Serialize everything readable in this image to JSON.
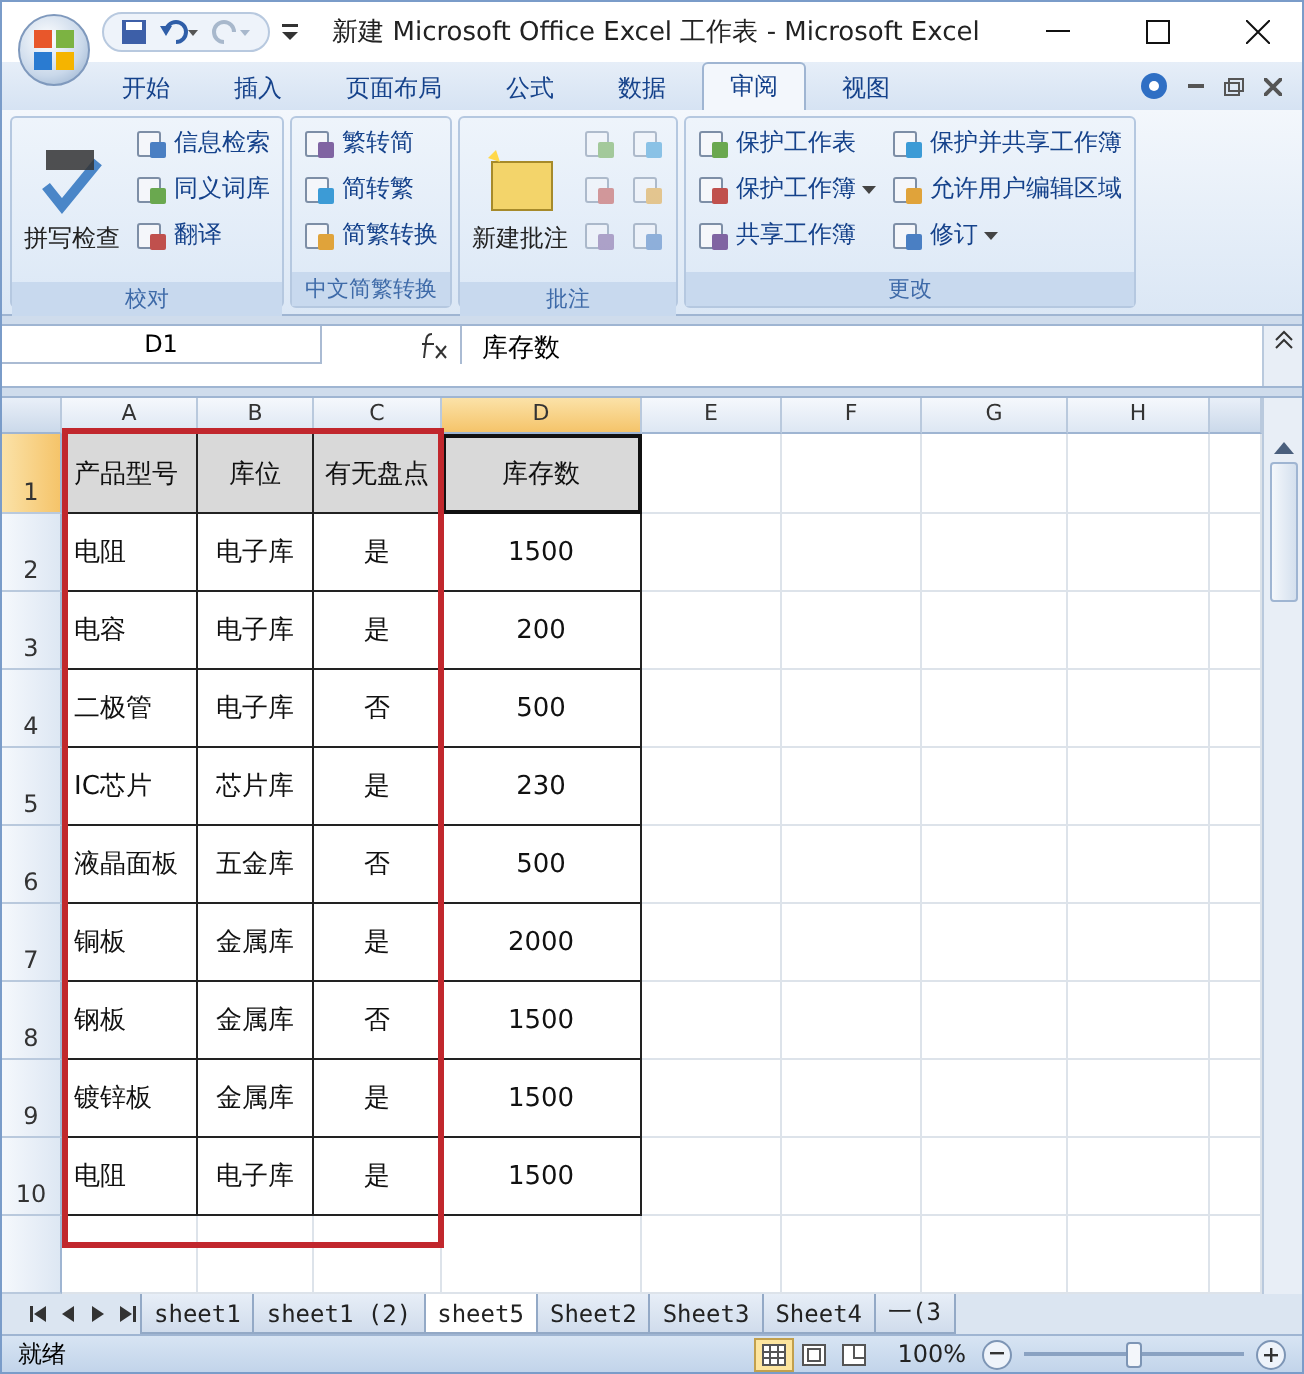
{
  "window": {
    "title": "新建 Microsoft Office Excel 工作表 - Microsoft Excel"
  },
  "ribbon_tabs": [
    {
      "label": "开始",
      "selected": false
    },
    {
      "label": "插入",
      "selected": false
    },
    {
      "label": "页面布局",
      "selected": false
    },
    {
      "label": "公式",
      "selected": false
    },
    {
      "label": "数据",
      "selected": false
    },
    {
      "label": "审阅",
      "selected": true
    },
    {
      "label": "视图",
      "selected": false
    }
  ],
  "ribbon_groups": [
    {
      "label": "校对",
      "columns": [
        [
          {
            "kind": "large",
            "label": "拼写检查"
          }
        ],
        [
          {
            "kind": "small",
            "label": "信息检索",
            "dropdown": false
          },
          {
            "kind": "small",
            "label": "同义词库",
            "dropdown": false
          },
          {
            "kind": "small",
            "label": "翻译",
            "dropdown": false
          }
        ]
      ]
    },
    {
      "label": "中文简繁转换",
      "columns": [
        [
          {
            "kind": "small",
            "label": "繁转简",
            "dropdown": false
          },
          {
            "kind": "small",
            "label": "简转繁",
            "dropdown": false
          },
          {
            "kind": "small",
            "label": "简繁转换",
            "dropdown": false
          }
        ]
      ]
    },
    {
      "label": "批注",
      "columns": [
        [
          {
            "kind": "large",
            "label": "新建批注"
          }
        ],
        [
          {
            "kind": "icon"
          },
          {
            "kind": "icon"
          },
          {
            "kind": "icon"
          }
        ],
        [
          {
            "kind": "icon"
          },
          {
            "kind": "icon"
          },
          {
            "kind": "icon"
          }
        ]
      ]
    },
    {
      "label": "更改",
      "columns": [
        [
          {
            "kind": "small",
            "label": "保护工作表",
            "dropdown": false
          },
          {
            "kind": "small",
            "label": "保护工作簿",
            "dropdown": true
          },
          {
            "kind": "small",
            "label": "共享工作簿",
            "dropdown": false
          }
        ],
        [
          {
            "kind": "small",
            "label": "保护并共享工作簿",
            "dropdown": false
          },
          {
            "kind": "small",
            "label": "允许用户编辑区域",
            "dropdown": false
          },
          {
            "kind": "small",
            "label": "修订",
            "dropdown": true
          }
        ]
      ]
    }
  ],
  "formula_bar": {
    "name_box": "D1",
    "formula": "库存数"
  },
  "columns": [
    {
      "label": "A",
      "selected": false
    },
    {
      "label": "B",
      "selected": false
    },
    {
      "label": "C",
      "selected": false
    },
    {
      "label": "D",
      "selected": true
    },
    {
      "label": "E",
      "selected": false
    },
    {
      "label": "F",
      "selected": false
    },
    {
      "label": "G",
      "selected": false
    },
    {
      "label": "H",
      "selected": false
    }
  ],
  "rows": [
    {
      "header": "1",
      "selected": true,
      "kind": "heading",
      "cells": [
        "产品型号",
        "库位",
        "有无盘点",
        "库存数"
      ]
    },
    {
      "header": "2",
      "selected": false,
      "kind": "data",
      "cells": [
        "电阻",
        "电子库",
        "是",
        "1500"
      ]
    },
    {
      "header": "3",
      "selected": false,
      "kind": "data",
      "cells": [
        "电容",
        "电子库",
        "是",
        "200"
      ]
    },
    {
      "header": "4",
      "selected": false,
      "kind": "data",
      "cells": [
        "二极管",
        "电子库",
        "否",
        "500"
      ]
    },
    {
      "header": "5",
      "selected": false,
      "kind": "data",
      "cells": [
        "IC芯片",
        "芯片库",
        "是",
        "230"
      ]
    },
    {
      "header": "6",
      "selected": false,
      "kind": "data",
      "cells": [
        "液晶面板",
        "五金库",
        "否",
        "500"
      ]
    },
    {
      "header": "7",
      "selected": false,
      "kind": "data",
      "cells": [
        "铜板",
        "金属库",
        "是",
        "2000"
      ]
    },
    {
      "header": "8",
      "selected": false,
      "kind": "data",
      "cells": [
        "钢板",
        "金属库",
        "否",
        "1500"
      ]
    },
    {
      "header": "9",
      "selected": false,
      "kind": "data",
      "cells": [
        "镀锌板",
        "金属库",
        "是",
        "1500"
      ]
    },
    {
      "header": "10",
      "selected": false,
      "kind": "data",
      "cells": [
        "电阻",
        "电子库",
        "是",
        "1500"
      ]
    }
  ],
  "sheet_tabs": [
    {
      "label": "sheet1",
      "selected": false
    },
    {
      "label": "sheet1 (2)",
      "selected": false
    },
    {
      "label": "sheet5",
      "selected": true
    },
    {
      "label": "Sheet2",
      "selected": false
    },
    {
      "label": "Sheet3",
      "selected": false
    },
    {
      "label": "Sheet4",
      "selected": false
    },
    {
      "label": "一(3",
      "selected": false
    }
  ],
  "status_bar": {
    "status": "就绪",
    "view_buttons": [
      {
        "kind": "normal",
        "selected": true
      },
      {
        "kind": "page-layout",
        "selected": false
      },
      {
        "kind": "page-break",
        "selected": false
      }
    ],
    "zoom": "100%",
    "zoom_slider": {
      "level": 0.5
    }
  }
}
